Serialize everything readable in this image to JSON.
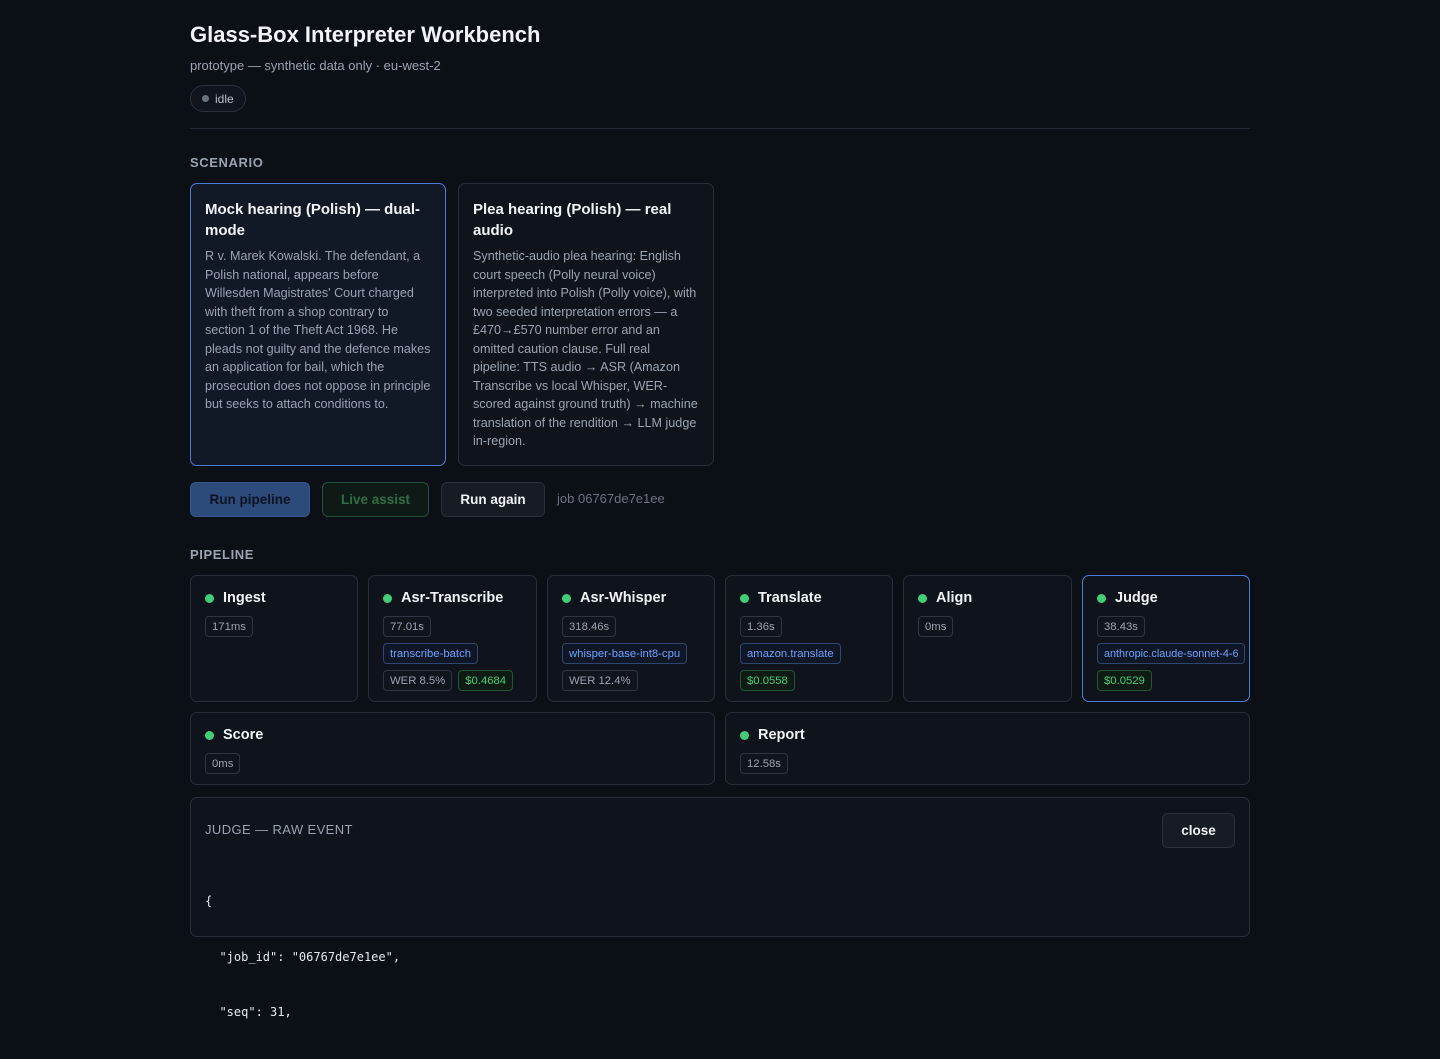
{
  "header": {
    "title": "Glass-Box Interpreter Workbench",
    "subtitle": "prototype — synthetic data only · eu-west-2",
    "status": "idle"
  },
  "scenario": {
    "section_label": "SCENARIO",
    "cards": [
      {
        "title": "Mock hearing (Polish) — dual-mode",
        "description": "R v. Marek Kowalski. The defendant, a Polish national, appears before Willesden Magistrates' Court charged with theft from a shop contrary to section 1 of the Theft Act 1968. He pleads not guilty and the defence makes an application for bail, which the prosecution does not oppose in principle but seeks to attach conditions to.",
        "selected": true
      },
      {
        "title": "Plea hearing (Polish) — real audio",
        "description": "Synthetic-audio plea hearing: English court speech (Polly neural voice) interpreted into Polish (Polly voice), with two seeded interpretation errors — a £470→£570 number error and an omitted caution clause. Full real pipeline: TTS audio → ASR (Amazon Transcribe vs local Whisper, WER-scored against ground truth) → machine translation of the rendition → LLM judge in-region.",
        "selected": false
      }
    ]
  },
  "actions": {
    "run_label": "Run pipeline",
    "live_label": "Live assist",
    "again_label": "Run again",
    "job": "job 06767de7e1ee"
  },
  "pipeline": {
    "section_label": "PIPELINE",
    "stages": [
      {
        "name": "Ingest",
        "time": "171ms",
        "status": "done"
      },
      {
        "name": "Asr-Transcribe",
        "time": "77.01s",
        "model": "transcribe-batch",
        "wer": "WER 8.5%",
        "cost": "$0.4684",
        "status": "done"
      },
      {
        "name": "Asr-Whisper",
        "time": "318.46s",
        "model": "whisper-base-int8-cpu",
        "wer": "WER 12.4%",
        "status": "done"
      },
      {
        "name": "Translate",
        "time": "1.36s",
        "model": "amazon.translate",
        "cost": "$0.0558",
        "status": "done"
      },
      {
        "name": "Align",
        "time": "0ms",
        "status": "done"
      },
      {
        "name": "Judge",
        "time": "38.43s",
        "model": "anthropic.claude-sonnet-4-6",
        "cost": "$0.0529",
        "status": "done",
        "selected": true
      },
      {
        "name": "Score",
        "time": "0ms",
        "status": "done"
      },
      {
        "name": "Report",
        "time": "12.58s",
        "status": "done"
      }
    ]
  },
  "event_panel": {
    "title": "JUDGE — RAW EVENT",
    "close_label": "close",
    "json_lines": [
      "{",
      "  \"job_id\": \"06767de7e1ee\",",
      "  \"seq\": 31,"
    ]
  },
  "colors": {
    "background": "#0b0f16",
    "accent": "#4d7dd1",
    "success": "#3fcf75",
    "model_chip": "#6ea0ff"
  }
}
